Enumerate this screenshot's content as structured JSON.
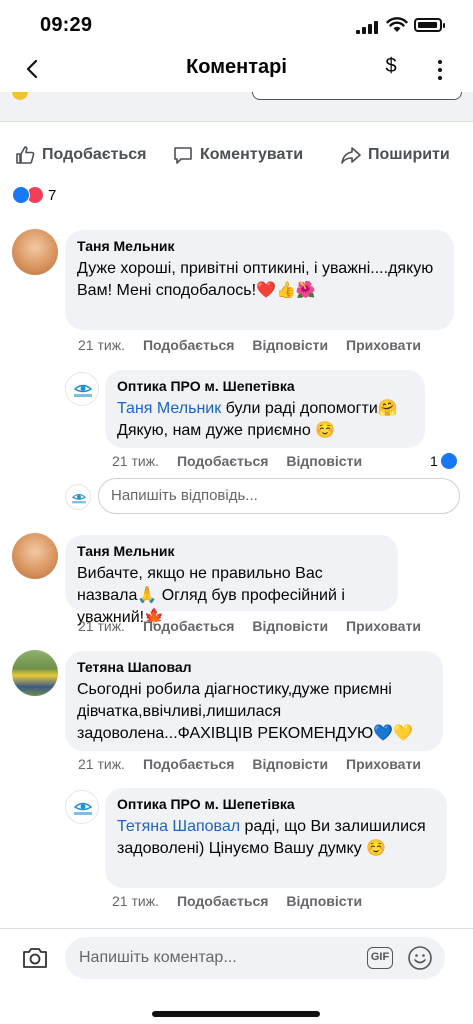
{
  "status_bar": {
    "time": "09:29",
    "battery_level": 0.8
  },
  "header": {
    "title": "Коментарі",
    "dollar_symbol": "$"
  },
  "actions": {
    "like": "Подобається",
    "comment": "Коментувати",
    "share": "Поширити"
  },
  "reactions": {
    "count": "7"
  },
  "comments": [
    {
      "author": "Таня Мельник",
      "text": "Дуже хороші, привітні оптикині, і уважні....дякую Вам! Мені сподобалось!❤️👍🌺",
      "time": "21 тиж.",
      "like": "Подобається",
      "reply": "Відповісти",
      "hide": "Приховати"
    },
    {
      "author": "Оптика ПРО м. Шепетівка",
      "mention": "Таня Мельник",
      "text": " були раді допомогти🤗 Дякую, нам дуже приємно ☺️",
      "time": "21 тиж.",
      "like": "Подобається",
      "reply": "Відповісти",
      "like_count": "1"
    },
    {
      "author": "Таня Мельник",
      "text": "Вибачте, якщо не правильно Вас назвала🙏 Огляд був професійний і уважний!🍁",
      "time": "21 тиж.",
      "like": "Подобається",
      "reply": "Відповісти",
      "hide": "Приховати"
    },
    {
      "author": "Тетяна Шаповал",
      "text": "Сьогодні робила діагностику,дуже приємні дівчатка,ввічливі,лишилася задоволена...ФАХІВЦІВ РЕКОМЕНДУЮ💙💛",
      "time": "21 тиж.",
      "like": "Подобається",
      "reply": "Відповісти",
      "hide": "Приховати"
    },
    {
      "author": "Оптика ПРО м. Шепетівка",
      "mention": "Тетяна Шаповал",
      "text": " раді, що Ви залишилися задоволені) Цінуємо Вашу думку ☺️",
      "time": "21 тиж.",
      "like": "Подобається",
      "reply": "Відповісти"
    }
  ],
  "reply_input": {
    "placeholder": "Напишіть відповідь..."
  },
  "composer": {
    "placeholder": "Напишіть коментар...",
    "gif_label": "GIF"
  }
}
